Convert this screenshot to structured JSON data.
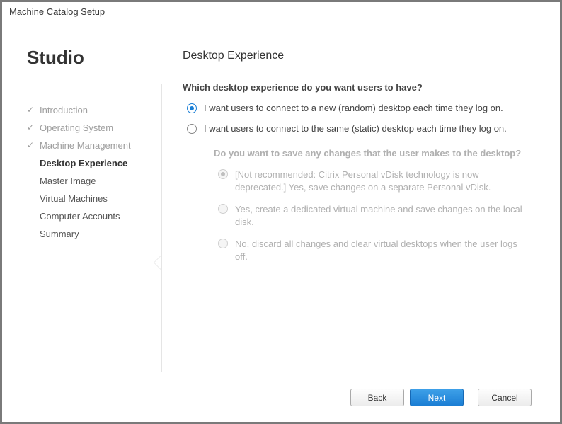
{
  "window": {
    "title": "Machine Catalog Setup"
  },
  "sidebar": {
    "heading": "Studio",
    "steps": [
      {
        "label": "Introduction",
        "state": "done"
      },
      {
        "label": "Operating System",
        "state": "done"
      },
      {
        "label": "Machine Management",
        "state": "done"
      },
      {
        "label": "Desktop Experience",
        "state": "active"
      },
      {
        "label": "Master Image",
        "state": "pending"
      },
      {
        "label": "Virtual Machines",
        "state": "pending"
      },
      {
        "label": "Computer Accounts",
        "state": "pending"
      },
      {
        "label": "Summary",
        "state": "pending"
      }
    ]
  },
  "main": {
    "heading": "Desktop Experience",
    "question": "Which desktop experience do you want users to have?",
    "options": [
      {
        "label": "I want users to connect to a new (random) desktop each time they log on.",
        "selected": true
      },
      {
        "label": "I want users to connect to the same (static) desktop each time they log on.",
        "selected": false
      }
    ],
    "sub": {
      "question": "Do you want to save any changes that the user makes to the desktop?",
      "enabled": false,
      "options": [
        {
          "label": "[Not recommended: Citrix Personal vDisk technology is now deprecated.] Yes, save changes on a separate Personal vDisk.",
          "selected": true
        },
        {
          "label": "Yes, create a dedicated virtual machine and save changes on the local disk.",
          "selected": false
        },
        {
          "label": "No, discard all changes and clear virtual desktops when the user logs off.",
          "selected": false
        }
      ]
    }
  },
  "footer": {
    "back": "Back",
    "next": "Next",
    "cancel": "Cancel"
  }
}
